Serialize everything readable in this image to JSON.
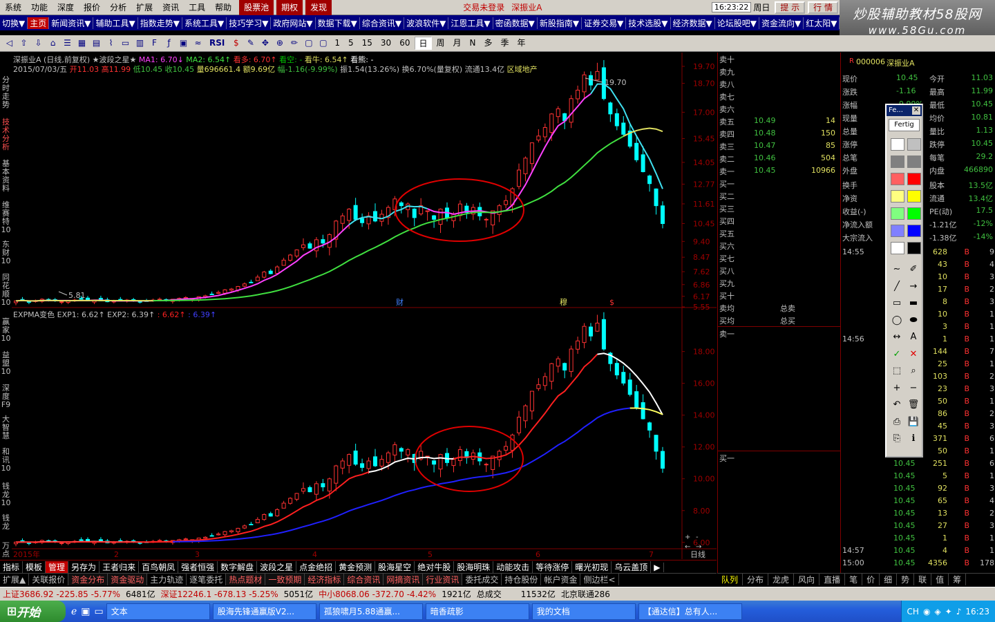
{
  "menu": {
    "items": [
      "系统",
      "功能",
      "深度",
      "报价",
      "分析",
      "扩展",
      "资讯",
      "工具",
      "帮助"
    ],
    "highlight": [
      "股票池",
      "期权",
      "发现"
    ],
    "notice": "交易未登录",
    "stock_notice": "深振业A",
    "clock": "16:23:22",
    "weekday": "周日",
    "right_buttons": [
      "提 示",
      "行 情"
    ]
  },
  "logo": {
    "line1": "炒股辅助教材58股网",
    "line2": "www.58Gu.com"
  },
  "nav": {
    "items": [
      "切换▼",
      "主页",
      "新闻资讯▼",
      "辅助工具▼",
      "指数走势▼",
      "系统工具▼",
      "技巧学习▼",
      "政府网站▼",
      "数据下载▼",
      "综合资讯▼",
      "波浪软件▼",
      "江恩工具▼",
      "密函数据▼",
      "新股指南▼",
      "证券交易▼",
      "技术选股▼",
      "经济数据▼",
      "论坛股吧▼",
      "资金流向▼",
      "红太阳▼"
    ],
    "active": 1
  },
  "toolbar": {
    "periods": [
      "1",
      "5",
      "15",
      "30",
      "60",
      "日",
      "周",
      "月",
      "N",
      "多",
      "季",
      "年"
    ],
    "selected": "日",
    "rsi": "RSI"
  },
  "leftnav": [
    "分时走势",
    "技术分析",
    "基本资料",
    "维赛特10",
    "东财10",
    "同花顺10"
  ],
  "leftnav2": [
    "赢家10",
    "益盟10",
    "深度F9",
    "大智慧",
    "和讯10",
    "钱龙10",
    "钱龙",
    "万点"
  ],
  "chart": {
    "header1": {
      "name": "深振业A",
      "mode": "(日线,前复权)",
      "indicator": "★波段之星★",
      "ma1": "MA1: 6.70↓",
      "ma2": "MA2: 6.54↑",
      "kanduo": "看多: 6.70↑",
      "kankong": "看空: -",
      "kanzhang": "看牛: 6.54↑",
      "kanxiong": "看熊: -"
    },
    "header2": {
      "date": "2015/07/03/五",
      "open": "开11.03",
      "high": "高11.99",
      "low": "低10.45",
      "close": "收10.45",
      "vol": "量696661.4",
      "amt": "额9.69亿",
      "chg": "幅-1.16(-9.99%)",
      "amp": "振1.54(13.26%)",
      "turn": "换6.70%(量复权)",
      "float": "流通13.4亿",
      "sector": "区域地产"
    },
    "header3": {
      "name": "EXPMA变色",
      "exp1": "EXP1: 6.62↑",
      "exp2": "EXP2: 6.39↑",
      "x1": ": 6.62↑",
      "x2": ": 6.39↑"
    },
    "top_axis": [
      "19.70",
      "18.70",
      "17.00",
      "15.45",
      "14.05",
      "12.77",
      "11.61",
      "10.45",
      "9.40",
      "8.47",
      "7.62",
      "6.86",
      "6.17",
      "5.55"
    ],
    "bot_axis": [
      "18.00",
      "16.00",
      "14.00",
      "12.00",
      "10.00",
      "8.00",
      "6.00"
    ],
    "max_label": "19.70",
    "min_label": "5.81",
    "markers": [
      "财",
      "穆",
      "$"
    ],
    "x_labels": [
      "2015年",
      "2",
      "3",
      "4",
      "5",
      "6",
      "7"
    ],
    "x_unit": "日线",
    "zoom": [
      "+",
      "-",
      "←",
      "→"
    ]
  },
  "chart_data": [
    {
      "type": "candlestick",
      "title": "深振业A 日线 前复权",
      "xlabel": "",
      "ylabel": "",
      "ylim": [
        5.55,
        19.7
      ],
      "close": [
        5.9,
        5.95,
        5.85,
        5.9,
        6.0,
        5.95,
        5.9,
        5.85,
        5.9,
        5.95,
        6.0,
        5.9,
        5.95,
        5.9,
        5.85,
        5.9,
        5.9,
        5.95,
        5.9,
        5.85,
        5.9,
        5.95,
        6.0,
        5.95,
        6.0,
        6.05,
        6.1,
        6.05,
        6.15,
        6.2,
        6.3,
        6.4,
        6.55,
        6.6,
        6.75,
        6.9,
        7.0,
        7.3,
        7.6,
        7.5,
        7.9,
        8.3,
        8.6,
        8.9,
        9.2,
        9.0,
        9.5,
        9.3,
        9.8,
        10.6,
        10.9,
        11.3,
        10.7,
        10.5,
        10.9,
        10.6,
        11.0,
        11.4,
        11.9,
        11.5,
        11.6,
        10.8,
        11.5,
        11.2,
        10.7,
        11.3,
        10.8,
        11.0,
        11.6,
        11.1,
        11.4,
        10.9,
        10.7,
        11.2,
        11.5,
        11.8,
        12.5,
        13.6,
        14.3,
        15.2,
        15.6,
        16.1,
        16.9,
        17.2,
        16.5,
        17.8,
        18.3,
        19.2,
        18.6,
        19.4,
        17.8,
        16.9,
        16.2,
        15.7,
        15.0,
        14.2,
        13.5,
        12.8,
        11.5,
        10.45
      ],
      "series": [
        {
          "name": "MA1",
          "last": 6.7
        },
        {
          "name": "MA2",
          "last": 6.54
        }
      ]
    },
    {
      "type": "candlestick",
      "title": "EXPMA变色",
      "ylim": [
        6,
        20
      ],
      "series": [
        {
          "name": "EXP1",
          "last": 6.62
        },
        {
          "name": "EXP2",
          "last": 6.39
        }
      ]
    }
  ],
  "quote": {
    "asks": [
      [
        "卖十",
        "",
        ""
      ],
      [
        "卖九",
        "",
        ""
      ],
      [
        "卖八",
        "",
        ""
      ],
      [
        "卖七",
        "",
        ""
      ],
      [
        "卖六",
        "",
        ""
      ],
      [
        "卖五",
        "10.49",
        "14"
      ],
      [
        "卖四",
        "10.48",
        "150"
      ],
      [
        "卖三",
        "10.47",
        "85"
      ],
      [
        "卖二",
        "10.46",
        "504"
      ],
      [
        "卖一",
        "10.45",
        "10966"
      ]
    ],
    "bids": [
      [
        "买一"
      ],
      [
        "买二"
      ],
      [
        "买三"
      ],
      [
        "买四"
      ],
      [
        "买五"
      ],
      [
        "买六"
      ],
      [
        "买七"
      ],
      [
        "买八"
      ],
      [
        "买九"
      ],
      [
        "买十"
      ]
    ],
    "avg": [
      [
        "卖均",
        "总卖"
      ],
      [
        "买均",
        "总买"
      ]
    ],
    "sell1": "卖一",
    "buy1": "买一"
  },
  "stock": {
    "code": "000006",
    "name": "深振业A",
    "rows": [
      [
        "现价",
        "10.45",
        "今开",
        "11.03"
      ],
      [
        "涨跌",
        "-1.16",
        "最高",
        "11.99"
      ],
      [
        "涨幅",
        "-9.99%",
        "最低",
        "10.45"
      ],
      [
        "现量",
        "",
        "均价",
        "10.81"
      ],
      [
        "总量",
        "",
        "量比",
        "1.13"
      ],
      [
        "涨停",
        "",
        "跌停",
        "10.45"
      ],
      [
        "总笔",
        "",
        "每笔",
        "29.2"
      ],
      [
        "外盘",
        "",
        "内盘",
        "466890"
      ]
    ],
    "rows2": [
      [
        "换手",
        "",
        "股本",
        "13.5亿"
      ],
      [
        "净资",
        "",
        "流通",
        "13.4亿"
      ],
      [
        "收益(-)",
        "",
        "PE(动)",
        "17.5"
      ],
      [
        "净流入额",
        "",
        "-1.21亿",
        "-12%"
      ],
      [
        "大宗流入",
        "",
        "-1.38亿",
        "-14%"
      ]
    ],
    "ticks": [
      [
        "14:55",
        "",
        "628",
        "B",
        "9"
      ],
      [
        "",
        "",
        "43",
        "B",
        "4"
      ],
      [
        "",
        "",
        "10",
        "B",
        "3"
      ],
      [
        "",
        "",
        "17",
        "B",
        "2"
      ],
      [
        "",
        "",
        "8",
        "B",
        "3"
      ],
      [
        "",
        "",
        "10",
        "B",
        "1"
      ],
      [
        "",
        "",
        "3",
        "B",
        "1"
      ],
      [
        "14:56",
        "",
        "1",
        "B",
        "1"
      ],
      [
        "",
        "",
        "144",
        "B",
        "7"
      ],
      [
        "",
        "",
        "25",
        "B",
        "1"
      ],
      [
        "",
        "",
        "103",
        "B",
        "2"
      ],
      [
        "",
        "",
        "23",
        "B",
        "3"
      ],
      [
        "",
        "",
        "50",
        "B",
        "1"
      ],
      [
        "",
        "",
        "86",
        "B",
        "2"
      ],
      [
        "",
        "",
        "45",
        "B",
        "3"
      ],
      [
        "",
        "",
        "371",
        "B",
        "6"
      ],
      [
        "",
        "",
        "50",
        "B",
        "1"
      ],
      [
        "",
        "10.45",
        "251",
        "B",
        "6"
      ],
      [
        "",
        "10.45",
        "5",
        "B",
        "1"
      ],
      [
        "",
        "10.45",
        "92",
        "B",
        "3"
      ],
      [
        "",
        "10.45",
        "65",
        "B",
        "4"
      ],
      [
        "",
        "10.45",
        "13",
        "B",
        "2"
      ],
      [
        "",
        "10.45",
        "27",
        "B",
        "3"
      ],
      [
        "",
        "10.45",
        "1",
        "B",
        "1"
      ],
      [
        "14:57",
        "10.45",
        "4",
        "B",
        "1"
      ],
      [
        "15:00",
        "10.45",
        "4356",
        "B",
        "178"
      ]
    ]
  },
  "palette": {
    "title": "Fe...",
    "fert": "Fertig"
  },
  "bottom_tabs": [
    "指标",
    "模板",
    "管理",
    "另存为",
    "王者归来",
    "百鸟朝凤",
    "强者恒强",
    "数字解盘",
    "波段之星",
    "点金绝招",
    "黄金预测",
    "股海星空",
    "绝对牛股",
    "股海明珠",
    "动能攻击",
    "等待涨停",
    "曙光初现",
    "乌云盖顶",
    "▶"
  ],
  "bottom_active": "管理",
  "bottom_tabs2": [
    "扩展▲",
    "关联报价",
    "资金分布",
    "资金驱动",
    "主力轨迹",
    "逐笔委托",
    "热点题材",
    "一致预期",
    "经济指标",
    "综合资讯",
    "网摘资讯",
    "行业资讯",
    "委托成交",
    "持仓股份",
    "帐户资金",
    "侧边栏<"
  ],
  "bottom_hl2": [
    "资金分布",
    "资金驱动",
    "热点题材",
    "一致预期",
    "经济指标",
    "综合资讯",
    "网摘资讯",
    "行业资讯"
  ],
  "right_tabs": [
    "队列",
    "分布",
    "龙虎",
    "风向",
    "直播",
    "笔",
    "价",
    "细",
    "势",
    "联",
    "值",
    "筹"
  ],
  "status": {
    "sh": "上证3686.92 -225.85 -5.77%",
    "sh_amt": "6481亿",
    "sz": "深证12246.1 -678.13 -5.25%",
    "sz_amt": "5051亿",
    "zx": "中小8068.06 -372.70 -4.42%",
    "zx_amt": "1921亿",
    "total_label": "总成交",
    "total": "11532亿",
    "server": "北京联通286"
  },
  "taskbar": {
    "start": "开始",
    "items": [
      "文本",
      "股海先锋通赢版V2...",
      "孤狼啸月5.88通赢...",
      "暗香疏影",
      "我的文档",
      "【通达信】总有人..."
    ],
    "tray_lang": "CH",
    "tray_time": "16:23"
  },
  "colors": {
    "up": "#ff3232",
    "down": "#00ffff",
    "ma_magenta": "#ff40ff",
    "ma_green": "#40e040",
    "ma_cyan": "#40e0f0",
    "ma_yellow": "#e0e060",
    "exp_red": "#ff2020",
    "exp_blue": "#2020ff",
    "circle": "#e00000"
  }
}
